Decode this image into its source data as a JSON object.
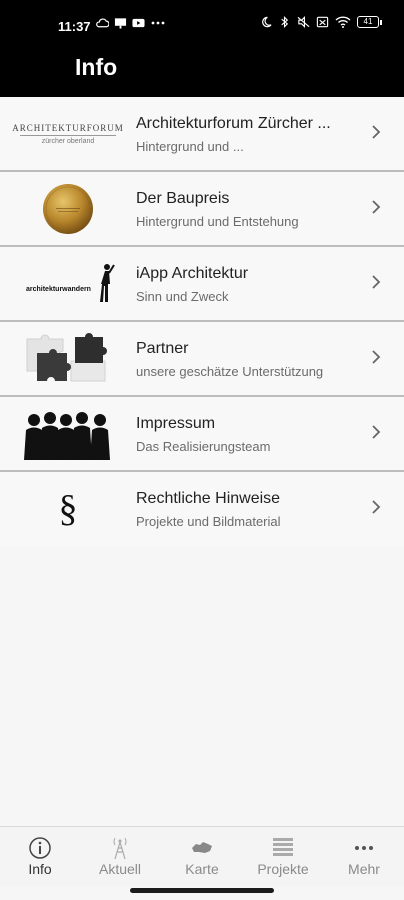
{
  "status_bar": {
    "time": "11:37",
    "battery": "41"
  },
  "header": {
    "title": "Info"
  },
  "list": [
    {
      "title": "Architekturforum Zürcher ...",
      "subtitle": "Hintergrund und ...",
      "logo_text": "ARCHITEKTURFORUM",
      "logo_sub": "zürcher oberland",
      "icon": "architekturforum-logo"
    },
    {
      "title": "Der Baupreis",
      "subtitle": "Hintergrund und Entstehung",
      "icon": "gold-medal"
    },
    {
      "title": "iApp Architektur",
      "subtitle": "Sinn und Zweck",
      "logo_text": "architekturwandern",
      "icon": "architekturwandern-logo"
    },
    {
      "title": "Partner",
      "subtitle": "unsere geschätze Unterstützung",
      "icon": "puzzle-pieces"
    },
    {
      "title": "Impressum",
      "subtitle": "Das Realisierungsteam",
      "icon": "team-silhouettes"
    },
    {
      "title": "Rechtliche Hinweise",
      "subtitle": "Projekte und Bildmaterial",
      "symbol": "§",
      "icon": "paragraph-symbol"
    }
  ],
  "tabbar": {
    "items": [
      {
        "label": "Info",
        "icon": "info-icon",
        "active": true
      },
      {
        "label": "Aktuell",
        "icon": "antenna-icon",
        "active": false
      },
      {
        "label": "Karte",
        "icon": "map-icon",
        "active": false
      },
      {
        "label": "Projekte",
        "icon": "list-icon",
        "active": false
      },
      {
        "label": "Mehr",
        "icon": "more-icon",
        "active": false
      }
    ]
  },
  "colors": {
    "header_bg": "#000000",
    "list_bg": "#f8f8f8",
    "divider": "#bdbdbd",
    "tab_inactive": "#8a8a8a"
  }
}
